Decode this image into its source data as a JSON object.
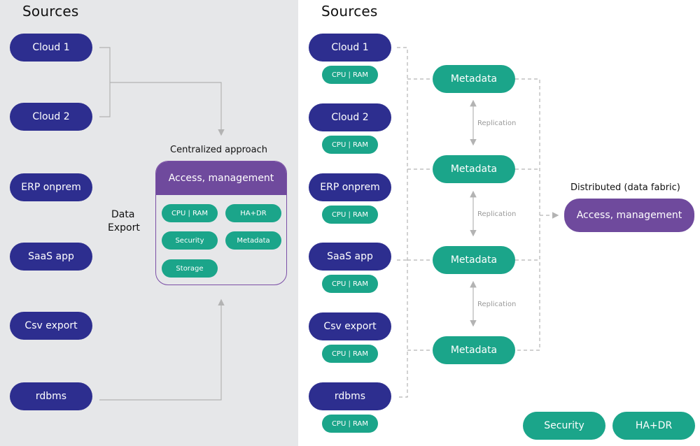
{
  "left": {
    "title": "Sources",
    "sources": [
      "Cloud 1",
      "Cloud 2",
      "ERP onprem",
      "SaaS app",
      "Csv export",
      "rdbms"
    ],
    "data_export_label": [
      "Data",
      "Export"
    ],
    "centralized": {
      "title": "Centralized approach",
      "header": "Access, management",
      "chips": [
        "CPU | RAM",
        "HA+DR",
        "Security",
        "Metadata",
        "Storage"
      ]
    }
  },
  "right": {
    "title": "Sources",
    "sources": [
      {
        "name": "Cloud 1",
        "chip": "CPU | RAM"
      },
      {
        "name": "Cloud 2",
        "chip": "CPU | RAM"
      },
      {
        "name": "ERP onprem",
        "chip": "CPU | RAM"
      },
      {
        "name": "SaaS app",
        "chip": "CPU | RAM"
      },
      {
        "name": "Csv export",
        "chip": "CPU | RAM"
      },
      {
        "name": "rdbms",
        "chip": "CPU | RAM"
      }
    ],
    "metadata_nodes": [
      "Metadata",
      "Metadata",
      "Metadata",
      "Metadata"
    ],
    "replication_labels": [
      "Replication",
      "Replication",
      "Replication"
    ],
    "distributed": {
      "title": "Distributed (data fabric)",
      "box": "Access, management"
    },
    "bottom_chips": [
      "Security",
      "HA+DR"
    ]
  },
  "colors": {
    "source": "#2d2e8f",
    "teal": "#1ba58a",
    "purple": "#6f4a9d",
    "connector": "#b3b3b3",
    "left_bg": "#e6e7e9"
  }
}
